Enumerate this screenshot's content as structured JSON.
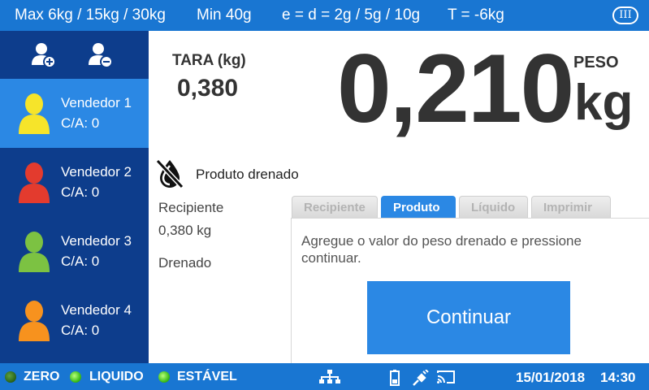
{
  "topbar": {
    "max": "Max 6kg / 15kg / 30kg",
    "min": "Min 40g",
    "division": "e = d = 2g / 5g / 10g",
    "tare_limit": "T = -6kg",
    "class_badge": "III"
  },
  "sidebar": {
    "add_user_icon": "add-user-icon",
    "remove_user_icon": "remove-user-icon",
    "vendors": [
      {
        "name": "Vendedor 1",
        "ca": "C/A: 0",
        "color": "#f6e42a",
        "active": true
      },
      {
        "name": "Vendedor 2",
        "ca": "C/A: 0",
        "color": "#e33b2e",
        "active": false
      },
      {
        "name": "Vendedor 3",
        "ca": "C/A: 0",
        "color": "#7cc242",
        "active": false
      },
      {
        "name": "Vendedor 4",
        "ca": "C/A: 0",
        "color": "#f7921e",
        "active": false
      }
    ]
  },
  "scale": {
    "tara_label": "TARA (kg)",
    "tara_value": "0,380",
    "weight": "0,210",
    "peso_label": "PESO",
    "unit": "kg"
  },
  "drained": {
    "title": "Produto drenado",
    "recipient_label": "Recipiente",
    "recipient_value": "0,380 kg",
    "drained_label": "Drenado"
  },
  "tabs": [
    {
      "label": "Recipiente",
      "active": false
    },
    {
      "label": "Produto",
      "active": true
    },
    {
      "label": "Líquido",
      "active": false
    },
    {
      "label": "Imprimir",
      "active": false
    }
  ],
  "panel": {
    "instruction": "Agregue o valor do peso drenado e pressione continuar.",
    "continue_label": "Continuar"
  },
  "statusbar": {
    "zero": "ZERO",
    "liquido": "LIQUIDO",
    "estavel": "ESTÁVEL",
    "date": "15/01/2018",
    "time": "14:30",
    "icons": [
      "network-icon",
      "battery-icon",
      "plug-icon",
      "cast-icon"
    ]
  },
  "colors": {
    "bar_blue": "#1976d2",
    "sidebar_navy": "#0d3d8c",
    "accent_blue": "#2b88e4",
    "led_green": "#3fbf1c"
  }
}
